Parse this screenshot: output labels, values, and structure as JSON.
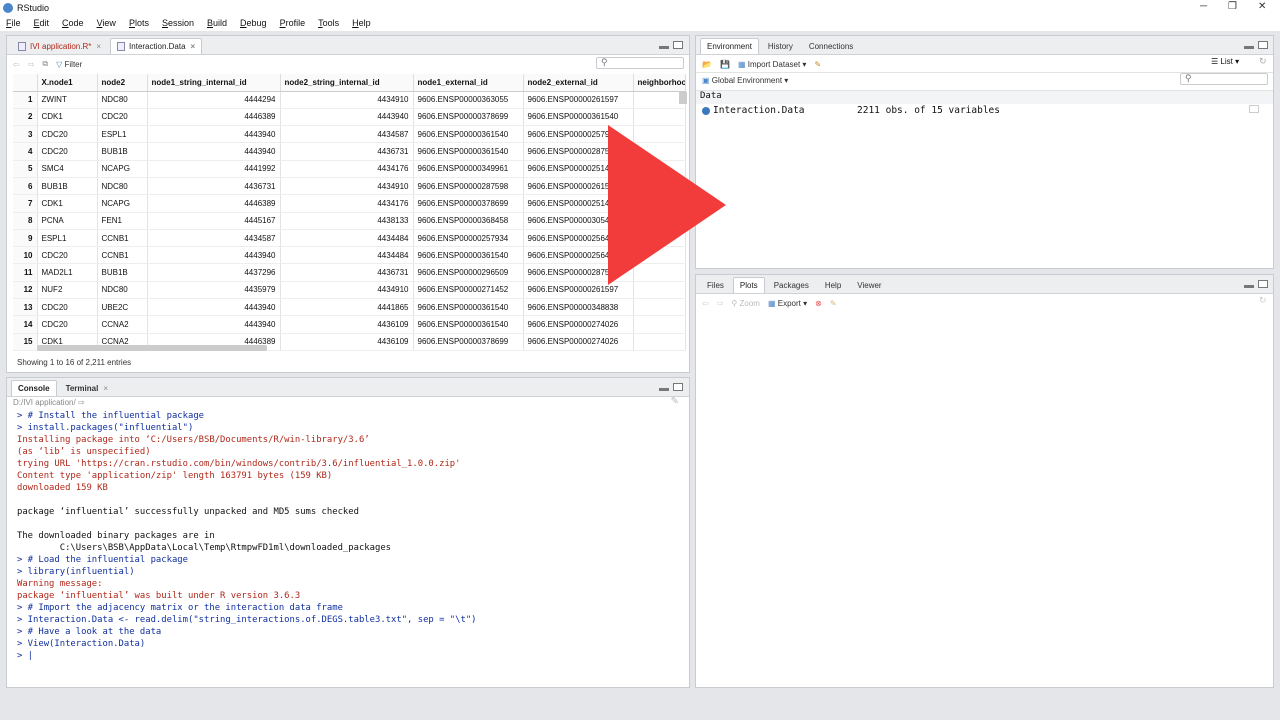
{
  "window": {
    "title": "RStudio"
  },
  "menu": [
    "File",
    "Edit",
    "Code",
    "View",
    "Plots",
    "Session",
    "Build",
    "Debug",
    "Profile",
    "Tools",
    "Help"
  ],
  "source_pane": {
    "tabs": [
      {
        "label": "IVI application.R*",
        "active": false
      },
      {
        "label": "Interaction.Data",
        "active": true
      }
    ],
    "filter_label": "Filter",
    "columns": [
      "",
      "X.node1",
      "node2",
      "node1_string_internal_id",
      "node2_string_internal_id",
      "node1_external_id",
      "node2_external_id",
      "neighborhood"
    ],
    "rows": [
      [
        "1",
        "ZWINT",
        "NDC80",
        "4444294",
        "4434910",
        "9606.ENSP00000363055",
        "9606.ENSP00000261597"
      ],
      [
        "2",
        "CDK1",
        "CDC20",
        "4446389",
        "4443940",
        "9606.ENSP00000378699",
        "9606.ENSP00000361540"
      ],
      [
        "3",
        "CDC20",
        "ESPL1",
        "4443940",
        "4434587",
        "9606.ENSP00000361540",
        "9606.ENSP00000257934"
      ],
      [
        "4",
        "CDC20",
        "BUB1B",
        "4443940",
        "4436731",
        "9606.ENSP00000361540",
        "9606.ENSP00000287598"
      ],
      [
        "5",
        "SMC4",
        "NCAPG",
        "4441992",
        "4434176",
        "9606.ENSP00000349961",
        "9606.ENSP00000251496"
      ],
      [
        "6",
        "BUB1B",
        "NDC80",
        "4436731",
        "4434910",
        "9606.ENSP00000287598",
        "9606.ENSP00000261597"
      ],
      [
        "7",
        "CDK1",
        "NCAPG",
        "4446389",
        "4434176",
        "9606.ENSP00000378699",
        "9606.ENSP00000251496"
      ],
      [
        "8",
        "PCNA",
        "FEN1",
        "4445167",
        "4438133",
        "9606.ENSP00000368458",
        "9606.ENSP00000305480"
      ],
      [
        "9",
        "ESPL1",
        "CCNB1",
        "4434587",
        "4434484",
        "9606.ENSP00000257934",
        "9606.ENSP00000256442"
      ],
      [
        "10",
        "CDC20",
        "CCNB1",
        "4443940",
        "4434484",
        "9606.ENSP00000361540",
        "9606.ENSP00000256442"
      ],
      [
        "11",
        "MAD2L1",
        "BUB1B",
        "4437296",
        "4436731",
        "9606.ENSP00000296509",
        "9606.ENSP00000287598"
      ],
      [
        "12",
        "NUF2",
        "NDC80",
        "4435979",
        "4434910",
        "9606.ENSP00000271452",
        "9606.ENSP00000261597"
      ],
      [
        "13",
        "CDC20",
        "UBE2C",
        "4443940",
        "4441865",
        "9606.ENSP00000361540",
        "9606.ENSP00000348838"
      ],
      [
        "14",
        "CDC20",
        "CCNA2",
        "4443940",
        "4436109",
        "9606.ENSP00000361540",
        "9606.ENSP00000274026"
      ],
      [
        "15",
        "CDK1",
        "CCNA2",
        "4446389",
        "4436109",
        "9606.ENSP00000378699",
        "9606.ENSP00000274026"
      ]
    ],
    "showing": "Showing 1 to 16 of 2,211 entries"
  },
  "console_pane": {
    "tabs": [
      {
        "label": "Console",
        "active": true
      },
      {
        "label": "Terminal",
        "active": false
      }
    ],
    "path": "D:/IVI application/",
    "lines": [
      {
        "kind": "cmd",
        "text": "> # Install the influential package"
      },
      {
        "kind": "cmd",
        "text": "> install.packages(\"influential\")"
      },
      {
        "kind": "err",
        "text": "Installing package into ‘C:/Users/BSB/Documents/R/win-library/3.6’"
      },
      {
        "kind": "err",
        "text": "(as ‘lib’ is unspecified)"
      },
      {
        "kind": "err",
        "text": "trying URL 'https://cran.rstudio.com/bin/windows/contrib/3.6/influential_1.0.0.zip'"
      },
      {
        "kind": "err",
        "text": "Content type 'application/zip' length 163791 bytes (159 KB)"
      },
      {
        "kind": "err",
        "text": "downloaded 159 KB"
      },
      {
        "kind": "out",
        "text": ""
      },
      {
        "kind": "out",
        "text": "package ‘influential’ successfully unpacked and MD5 sums checked"
      },
      {
        "kind": "out",
        "text": ""
      },
      {
        "kind": "out",
        "text": "The downloaded binary packages are in"
      },
      {
        "kind": "out",
        "text": "        C:\\Users\\BSB\\AppData\\Local\\Temp\\RtmpwFD1ml\\downloaded_packages"
      },
      {
        "kind": "cmd",
        "text": "> # Load the influential package"
      },
      {
        "kind": "cmd",
        "text": "> library(influential)"
      },
      {
        "kind": "err",
        "text": "Warning message:"
      },
      {
        "kind": "err",
        "text": "package ‘influential’ was built under R version 3.6.3"
      },
      {
        "kind": "cmd",
        "text": "> # Import the adjacency matrix or the interaction data frame"
      },
      {
        "kind": "cmd",
        "text": "> Interaction.Data <- read.delim(\"string_interactions.of.DEGS.table3.txt\", sep = \"\\t\")"
      },
      {
        "kind": "cmd",
        "text": "> # Have a look at the data"
      },
      {
        "kind": "cmd",
        "text": "> View(Interaction.Data)"
      },
      {
        "kind": "cmd",
        "text": "> |"
      }
    ]
  },
  "env_pane": {
    "tabs": [
      {
        "label": "Environment",
        "active": true
      },
      {
        "label": "History",
        "active": false
      },
      {
        "label": "Connections",
        "active": false
      }
    ],
    "import_label": "Import Dataset",
    "list_label": "List",
    "scope_label": "Global Environment",
    "section": "Data",
    "object_name": "Interaction.Data",
    "object_desc": "2211 obs. of 15 variables"
  },
  "files_pane": {
    "tabs": [
      {
        "label": "Files",
        "active": false
      },
      {
        "label": "Plots",
        "active": true
      },
      {
        "label": "Packages",
        "active": false
      },
      {
        "label": "Help",
        "active": false
      },
      {
        "label": "Viewer",
        "active": false
      }
    ],
    "zoom_label": "Zoom",
    "export_label": "Export"
  },
  "colors": {
    "play_button": "#f23c3c",
    "command_text": "#0f2fa0",
    "message_text": "#b0281a"
  }
}
